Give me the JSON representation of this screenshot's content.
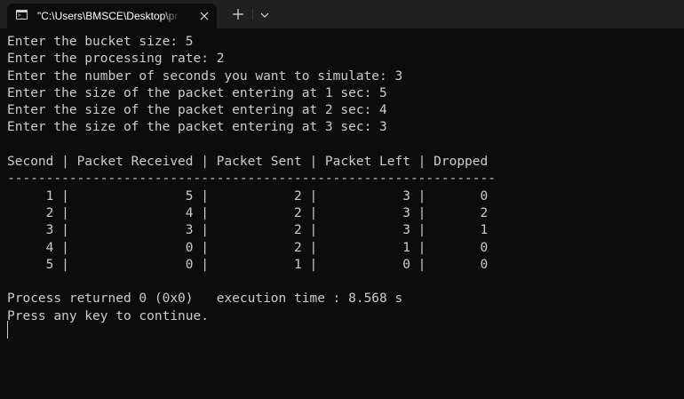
{
  "window": {
    "tab_title": "\"C:\\Users\\BMSCE\\Desktop\\pr",
    "tab_icon": "console-icon",
    "tab_icon_text": ">_",
    "close_icon": "close-icon",
    "new_tab_icon": "plus-icon",
    "dropdown_icon": "chevron-down-icon"
  },
  "console": {
    "lines": [
      "Enter the bucket size: 5",
      "Enter the processing rate: 2",
      "Enter the number of seconds you want to simulate: 3",
      "Enter the size of the packet entering at 1 sec: 5",
      "Enter the size of the packet entering at 2 sec: 4",
      "Enter the size of the packet entering at 3 sec: 3",
      "",
      "Second | Packet Received | Packet Sent | Packet Left | Dropped",
      "---------------------------------------------------------------",
      "     1 |               5 |           2 |           3 |       0",
      "     2 |               4 |           2 |           3 |       2",
      "     3 |               3 |           2 |           3 |       1",
      "     4 |               0 |           2 |           1 |       0",
      "     5 |               0 |           1 |           0 |       0",
      "",
      "Process returned 0 (0x0)   execution time : 8.568 s",
      "Press any key to continue."
    ]
  }
}
